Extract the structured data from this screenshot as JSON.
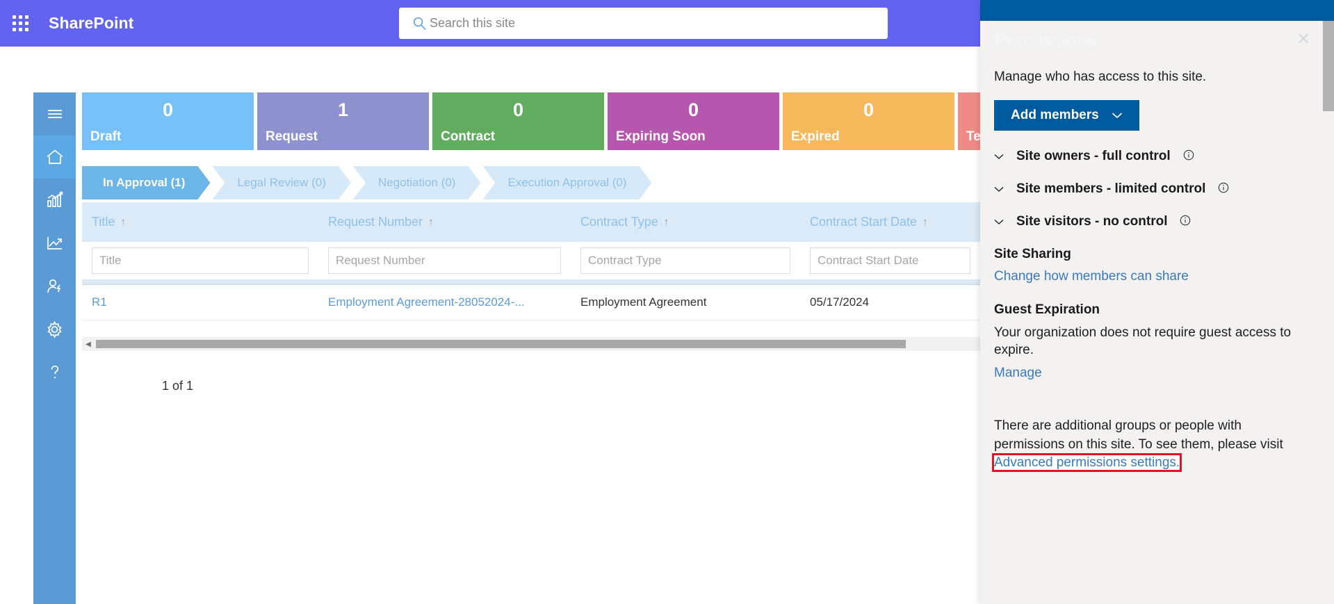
{
  "suite": {
    "brand": "SharePoint",
    "waffle_icon": "app-launcher-icon",
    "search": {
      "icon": "search-icon",
      "placeholder": "Search this site",
      "value": ""
    }
  },
  "rail": {
    "items": [
      {
        "icon": "hamburger-menu-icon",
        "name": "menu-toggle"
      },
      {
        "icon": "home-icon",
        "name": "home",
        "active": true
      },
      {
        "icon": "bar-chart-icon",
        "name": "reports"
      },
      {
        "icon": "trend-line-icon",
        "name": "analytics"
      },
      {
        "icon": "user-power-icon",
        "name": "user-admin"
      },
      {
        "icon": "gear-icon",
        "name": "settings"
      },
      {
        "icon": "question-mark-icon",
        "name": "help"
      }
    ]
  },
  "tiles": [
    {
      "count": "0",
      "label": "Draft",
      "color": "#74c0f7"
    },
    {
      "count": "1",
      "label": "Request",
      "color": "#8d92ce"
    },
    {
      "count": "0",
      "label": "Contract",
      "color": "#61ac5e"
    },
    {
      "count": "0",
      "label": "Expiring Soon",
      "color": "#b557ad"
    },
    {
      "count": "0",
      "label": "Expired",
      "color": "#f5b95c"
    },
    {
      "count": "",
      "label": "Term",
      "color": "#ef8b86",
      "clipped": true
    }
  ],
  "stages": [
    {
      "label": "In Approval (1)",
      "active": true
    },
    {
      "label": "Legal Review (0)",
      "active": false
    },
    {
      "label": "Negotiation (0)",
      "active": false
    },
    {
      "label": "Execution Approval (0)",
      "active": false
    }
  ],
  "table": {
    "columns": [
      {
        "header": "Title",
        "sort": "↑",
        "filter_placeholder": "Title"
      },
      {
        "header": "Request Number",
        "sort": "↑",
        "filter_placeholder": "Request Number"
      },
      {
        "header": "Contract Type",
        "sort": "↑",
        "filter_placeholder": "Contract Type"
      },
      {
        "header": "Contract Start Date",
        "sort": "↑",
        "filter_placeholder": "Contract Start Date"
      }
    ],
    "rows": [
      {
        "title": "R1",
        "request_number": "Employment Agreement-28052024-...",
        "contract_type": "Employment Agreement",
        "contract_start_date": "05/17/2024"
      }
    ],
    "paging": "1 of 1",
    "scroll_left_arrow": "◀",
    "scroll_right_arrow": "▶"
  },
  "panel": {
    "title": "Permissions",
    "close_icon": "close-icon",
    "subtitle": "Manage who has access to this site.",
    "add_members_label": "Add members",
    "add_members_chevron": "chevron-down-icon",
    "groups": [
      {
        "label": "Site owners - full control",
        "chevron": "⌄",
        "info": "info-icon"
      },
      {
        "label": "Site members - limited control",
        "chevron": "⌄",
        "info": "info-icon"
      },
      {
        "label": "Site visitors - no control",
        "chevron": "⌄",
        "info": "info-icon"
      }
    ],
    "site_sharing": {
      "heading": "Site Sharing",
      "link": "Change how members can share"
    },
    "guest_expiration": {
      "heading": "Guest Expiration",
      "text": "Your organization does not require guest access to expire.",
      "link": "Manage"
    },
    "footnote": {
      "text_before": "There are additional groups or people with permissions on this site. To see them, please visit ",
      "link": "Advanced permissions settings.",
      "highlight_color": "#e81123"
    }
  }
}
